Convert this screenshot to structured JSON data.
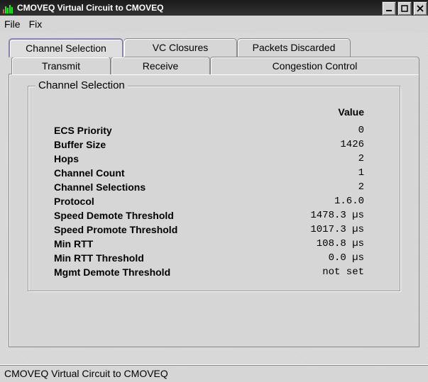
{
  "window": {
    "title": "CMOVEQ Virtual Circuit to CMOVEQ"
  },
  "menu": {
    "file": "File",
    "fix": "Fix"
  },
  "tabs": {
    "top": {
      "channel_selection": "Channel Selection",
      "vc_closures": "VC Closures",
      "packets_discarded": "Packets Discarded"
    },
    "sub": {
      "transmit": "Transmit",
      "receive": "Receive",
      "congestion_control": "Congestion Control"
    }
  },
  "group": {
    "title": "Channel Selection",
    "col_value": "Value",
    "rows": {
      "ecs_priority": {
        "label": "ECS Priority",
        "value": "0"
      },
      "buffer_size": {
        "label": "Buffer Size",
        "value": "1426"
      },
      "hops": {
        "label": "Hops",
        "value": "2"
      },
      "channel_count": {
        "label": "Channel Count",
        "value": "1"
      },
      "channel_selections": {
        "label": "Channel Selections",
        "value": "2"
      },
      "protocol": {
        "label": "Protocol",
        "value": "1.6.0"
      },
      "speed_demote": {
        "label": "Speed Demote Threshold",
        "value": "1478.3 µs"
      },
      "speed_promote": {
        "label": "Speed Promote Threshold",
        "value": "1017.3 µs"
      },
      "min_rtt": {
        "label": "Min RTT",
        "value": "108.8 µs"
      },
      "min_rtt_threshold": {
        "label": "Min RTT Threshold",
        "value": "0.0 µs"
      },
      "mgmt_demote": {
        "label": "Mgmt Demote Threshold",
        "value": "not set"
      }
    }
  },
  "status": {
    "text": "CMOVEQ Virtual Circuit to CMOVEQ"
  }
}
